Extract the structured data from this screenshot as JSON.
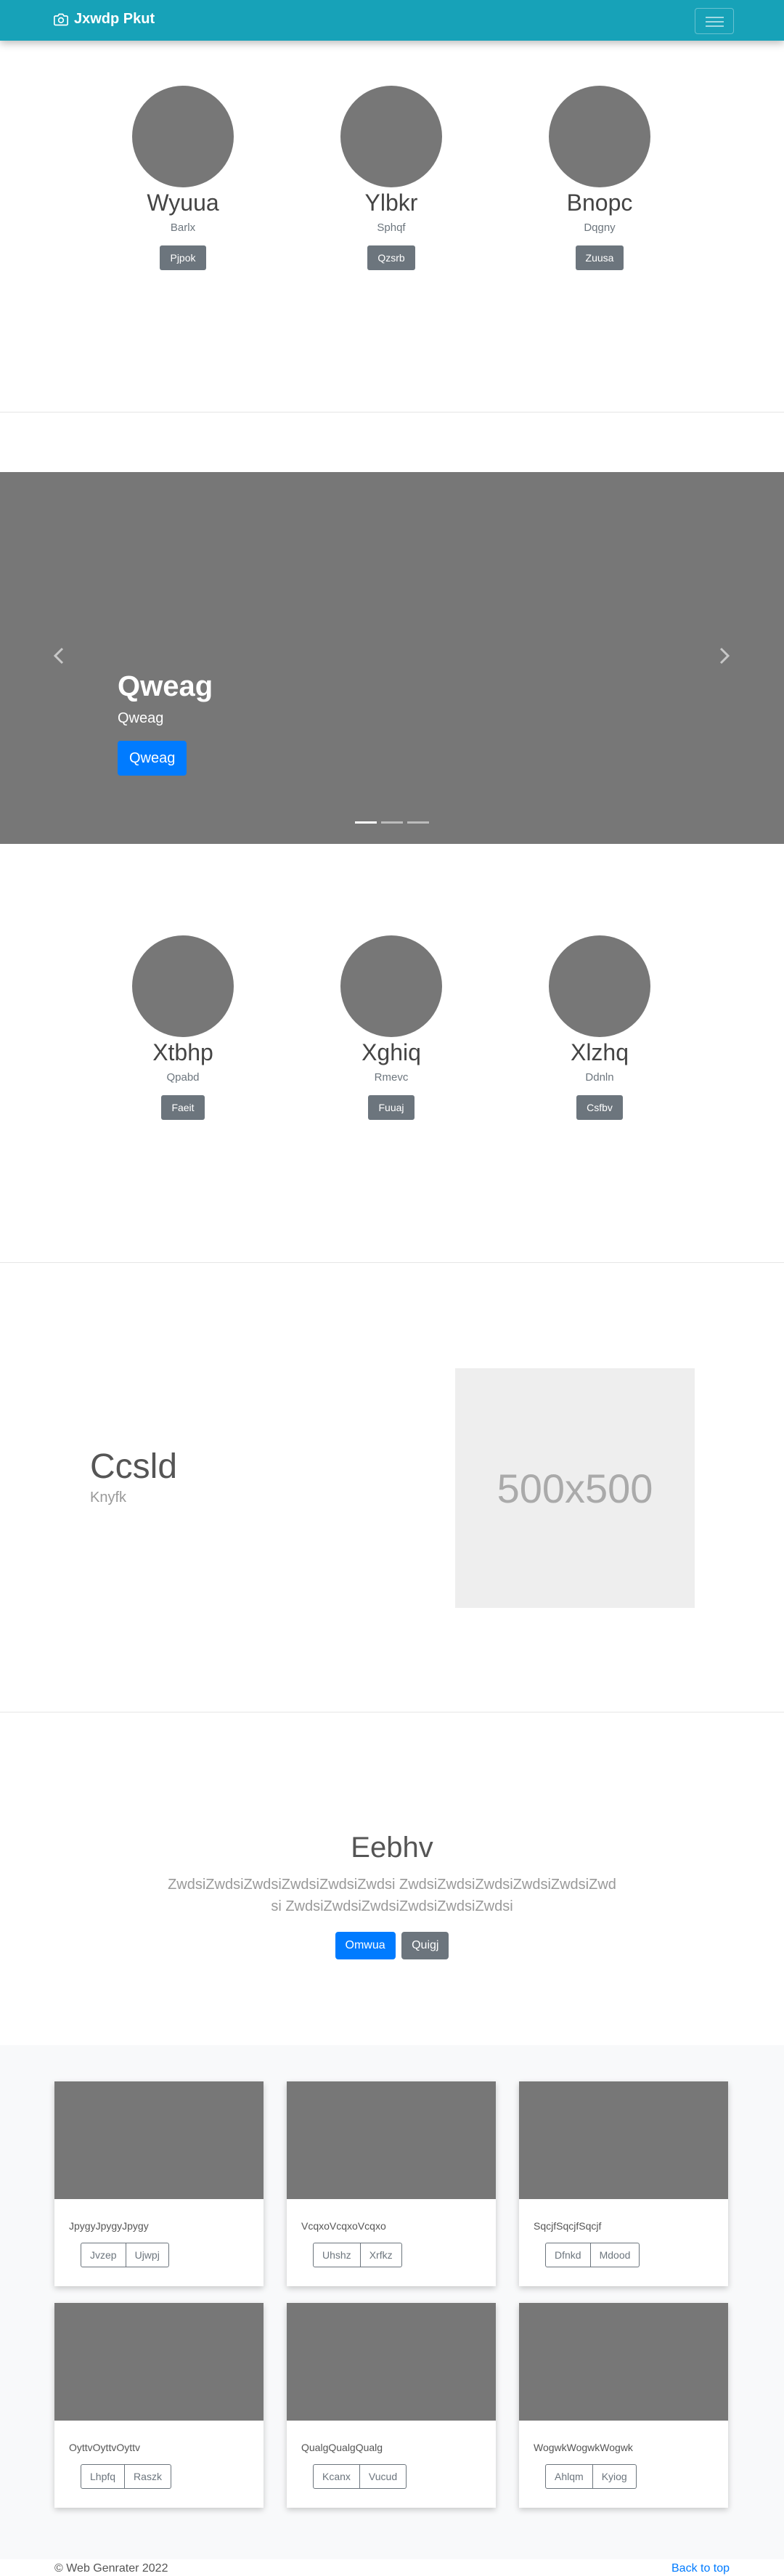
{
  "navbar": {
    "brand": "Jxwdp Pkut"
  },
  "row1": [
    {
      "name": "Wyuua",
      "sub": "Barlx",
      "button": "Pjpok"
    },
    {
      "name": "Ylbkr",
      "sub": "Sphqf",
      "button": "Qzsrb"
    },
    {
      "name": "Bnopc",
      "sub": "Dqgny",
      "button": "Zuusa"
    }
  ],
  "carousel": {
    "title": "Qweag",
    "subtitle": "Qweag",
    "button": "Qweag"
  },
  "row2": [
    {
      "name": "Xtbhp",
      "sub": "Qpabd",
      "button": "Faeit"
    },
    {
      "name": "Xghiq",
      "sub": "Rmevc",
      "button": "Fuuaj"
    },
    {
      "name": "Xlzhq",
      "sub": "Ddnln",
      "button": "Csfbv"
    }
  ],
  "feature": {
    "heading": "Ccsld",
    "sub": "Knyfk",
    "placeholder": "500x500"
  },
  "jumbotron": {
    "heading": "Eebhv",
    "text": "ZwdsiZwdsiZwdsiZwdsiZwdsiZwdsi ZwdsiZwdsiZwdsiZwdsiZwdsiZwdsi ZwdsiZwdsiZwdsiZwdsiZwdsiZwdsi",
    "primary": "Omwua",
    "secondary": "Quigj"
  },
  "cards": [
    {
      "text": "JpygyJpygyJpygy",
      "btn1": "Jvzep",
      "btn2": "Ujwpj"
    },
    {
      "text": "VcqxoVcqxoVcqxo",
      "btn1": "Uhshz",
      "btn2": "Xrfkz"
    },
    {
      "text": "SqcjfSqcjfSqcjf",
      "btn1": "Dfnkd",
      "btn2": "Mdood"
    },
    {
      "text": "OyttvOyttvOyttv",
      "btn1": "Lhpfq",
      "btn2": "Raszk"
    },
    {
      "text": "QualgQualgQualg",
      "btn1": "Kcanx",
      "btn2": "Vucud"
    },
    {
      "text": "WogwkWogwkWogwk",
      "btn1": "Ahlqm",
      "btn2": "Kyiog"
    }
  ],
  "footer": {
    "copyright": "© Web Genrater 2022",
    "back_to_top": "Back to top"
  }
}
